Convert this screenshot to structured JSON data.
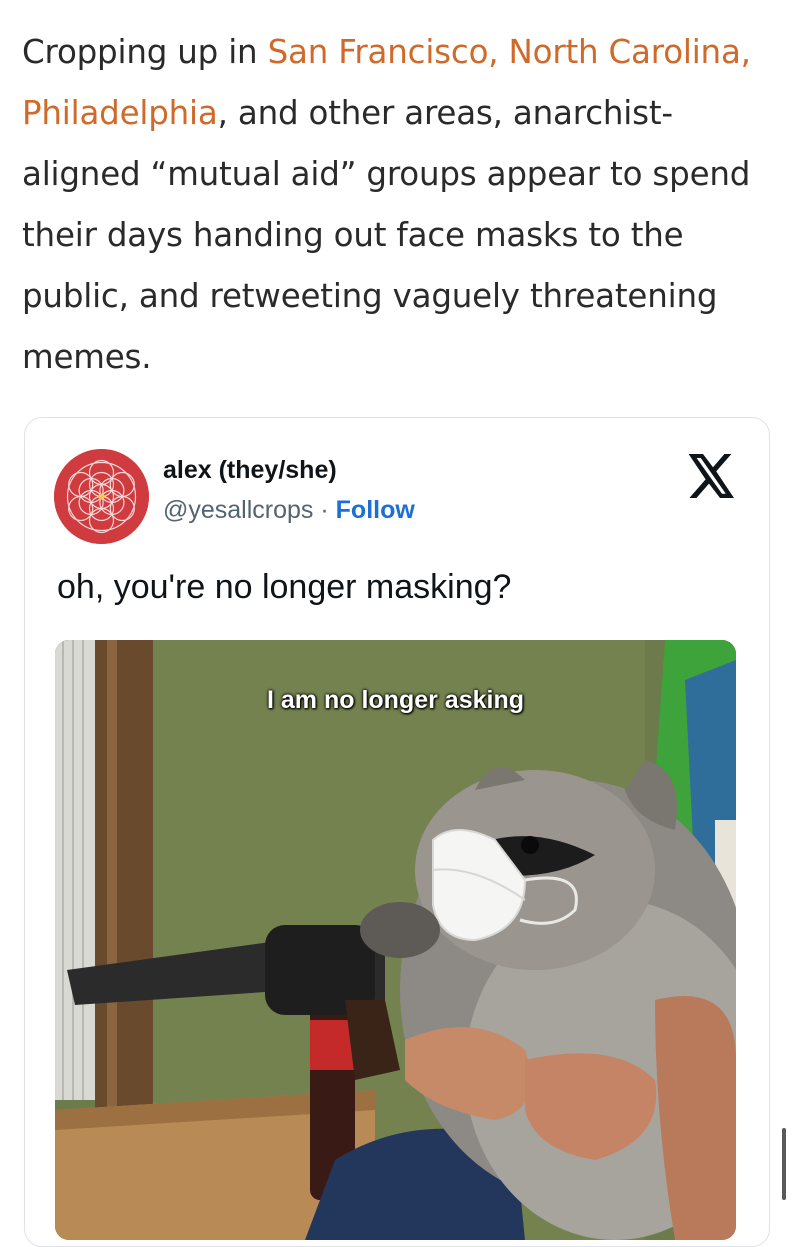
{
  "article": {
    "intro": "Cropping up in ",
    "link_text": "San Francisco, North Carolina, Philadelphia",
    "rest": ", and other areas, anarchist-aligned “mutual aid” groups appear to spend their days handing out face masks to the public, and retweeting vaguely threatening memes."
  },
  "tweet": {
    "display_name": "alex (they/she)",
    "handle": "@yesallcrops",
    "separator": " · ",
    "follow_label": "Follow",
    "text": "oh, you're no longer masking?",
    "media_caption": "I am no longer asking"
  },
  "icons": {
    "platform": "x-logo-icon",
    "avatar": "mandala-avatar"
  },
  "colors": {
    "link": "#d06a2a",
    "follow": "#1d6fd8",
    "avatar_bg": "#cf3b3f"
  }
}
